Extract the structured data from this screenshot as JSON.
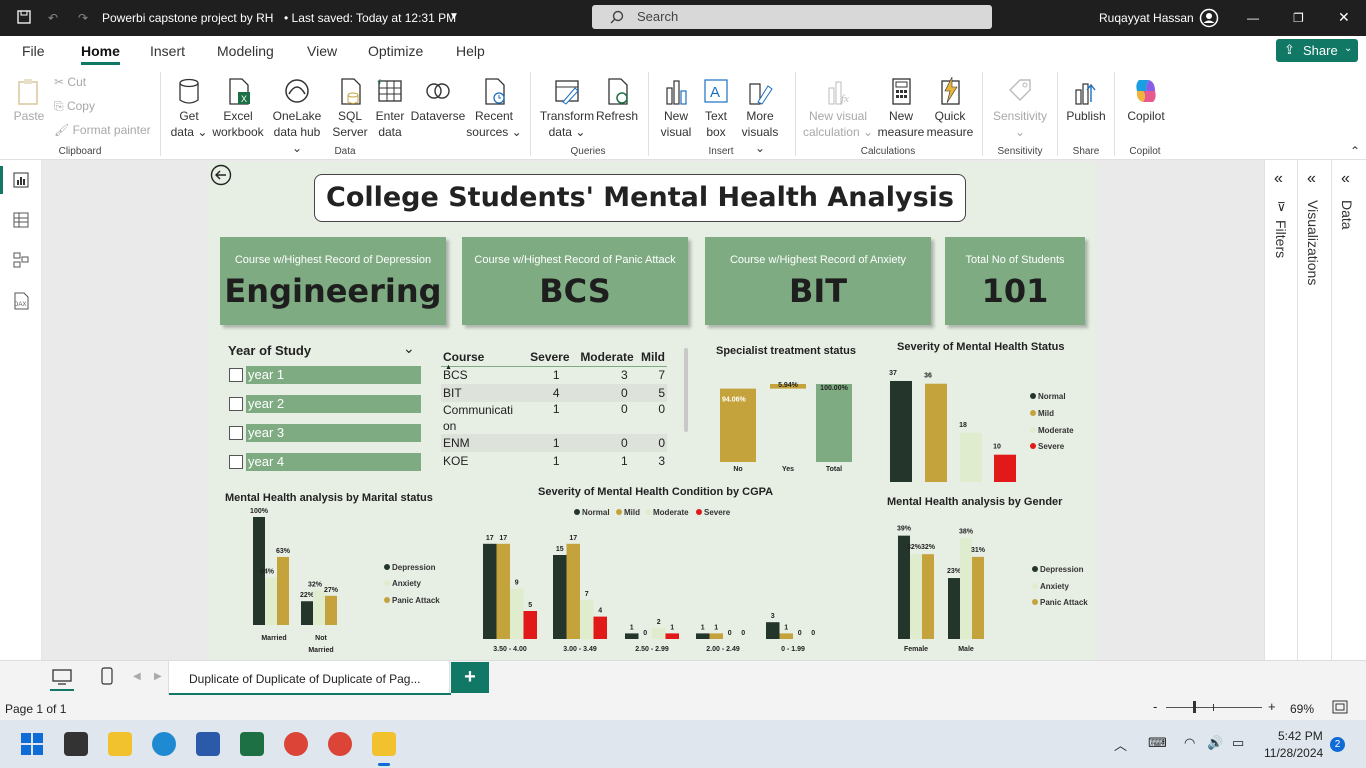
{
  "app": {
    "title": "Powerbi capstone project by RH",
    "saved": "Last saved: Today at 12:31 PM",
    "search_placeholder": "Search",
    "user": "Ruqayyat Hassan"
  },
  "menu": {
    "items": [
      "File",
      "Home",
      "Insert",
      "Modeling",
      "View",
      "Optimize",
      "Help"
    ],
    "share": "Share"
  },
  "ribbon": {
    "paste": "Paste",
    "cut": "Cut",
    "copy": "Copy",
    "format_painter": "Format painter",
    "clipboard": "Clipboard",
    "get_data": [
      "Get",
      "data"
    ],
    "excel": [
      "Excel",
      "workbook"
    ],
    "onelake": [
      "OneLake",
      "data hub"
    ],
    "sql": [
      "SQL",
      "Server"
    ],
    "enter": [
      "Enter",
      "data"
    ],
    "dataverse": "Dataverse",
    "recent": [
      "Recent",
      "sources"
    ],
    "data": "Data",
    "transform": [
      "Transform",
      "data"
    ],
    "refresh": "Refresh",
    "queries": "Queries",
    "new_visual": [
      "New",
      "visual"
    ],
    "text_box": [
      "Text",
      "box"
    ],
    "more_visuals": [
      "More",
      "visuals"
    ],
    "insert": "Insert",
    "new_visual_calc": [
      "New visual",
      "calculation"
    ],
    "new_measure": [
      "New",
      "measure"
    ],
    "quick_measure": [
      "Quick",
      "measure"
    ],
    "calculations": "Calculations",
    "sensitivity": "Sensitivity",
    "sensitivity_group": "Sensitivity",
    "publish": "Publish",
    "share": "Share",
    "copilot": "Copilot",
    "copilot_group": "Copilot"
  },
  "panes": {
    "filters": "Filters",
    "visualizations": "Visualizations",
    "data": "Data"
  },
  "report": {
    "title": "College Students' Mental Health Analysis",
    "kpis": [
      {
        "label": "Course w/Highest Record of Depression",
        "value": "Engineering"
      },
      {
        "label": "Course w/Highest Record of Panic Attack",
        "value": "BCS"
      },
      {
        "label": "Course w/Highest Record of Anxiety",
        "value": "BIT"
      },
      {
        "label": "Total No of Students",
        "value": "101"
      }
    ],
    "slicer": {
      "title": "Year of Study",
      "items": [
        "year 1",
        "year 2",
        "year 3",
        "year 4"
      ]
    },
    "table": {
      "headers": [
        "Course",
        "Severe",
        "Moderate",
        "Mild"
      ],
      "rows": [
        [
          "BCS",
          "1",
          "3",
          "7"
        ],
        [
          "BIT",
          "4",
          "0",
          "5"
        ],
        [
          "Communicati on",
          "1",
          "0",
          "0"
        ],
        [
          "ENM",
          "1",
          "0",
          "0"
        ],
        [
          "KOE",
          "1",
          "1",
          "3"
        ]
      ]
    },
    "colors": {
      "normal": "#24362b",
      "mild": "#c5a33c",
      "moderate": "#dfeccd",
      "severe": "#e11919",
      "green": "#7eab82"
    }
  },
  "chart_data": [
    {
      "type": "bar",
      "title": "Specialist treatment status",
      "categories": [
        "No",
        "Yes",
        "Total"
      ],
      "values": [
        94.06,
        5.94,
        100.0
      ],
      "labels": [
        "94.06%",
        "5.94%",
        "100.00%"
      ]
    },
    {
      "type": "bar",
      "title": "Severity of Mental Health Status",
      "categories": [
        "Normal",
        "Mild",
        "Moderate",
        "Severe"
      ],
      "values": [
        37,
        36,
        18,
        10
      ],
      "legend": [
        "Normal",
        "Mild",
        "Moderate",
        "Severe"
      ]
    },
    {
      "type": "bar",
      "title": "Mental Health analysis by Marital status",
      "categories": [
        "Married",
        "Not Married"
      ],
      "series": [
        {
          "name": "Depression",
          "values": [
            100,
            22
          ]
        },
        {
          "name": "Anxiety",
          "values": [
            44,
            32
          ]
        },
        {
          "name": "Panic Attack",
          "values": [
            63,
            27
          ]
        }
      ],
      "labels": [
        [
          "100%",
          "22%"
        ],
        [
          "44%",
          "32%"
        ],
        [
          "63%",
          "27%"
        ]
      ]
    },
    {
      "type": "bar",
      "title": "Severity of Mental Health Condition by CGPA",
      "categories": [
        "3.50 - 4.00",
        "3.00 - 3.49",
        "2.50 - 2.99",
        "2.00 - 2.49",
        "0 - 1.99"
      ],
      "series": [
        {
          "name": "Normal",
          "values": [
            17,
            15,
            1,
            1,
            3
          ]
        },
        {
          "name": "Mild",
          "values": [
            17,
            17,
            0,
            1,
            1
          ]
        },
        {
          "name": "Moderate",
          "values": [
            9,
            7,
            2,
            0,
            0
          ]
        },
        {
          "name": "Severe",
          "values": [
            5,
            4,
            1,
            0,
            0
          ]
        }
      ]
    },
    {
      "type": "bar",
      "title": "Mental Health analysis by Gender",
      "categories": [
        "Female",
        "Male"
      ],
      "series": [
        {
          "name": "Depression",
          "values": [
            39,
            23
          ]
        },
        {
          "name": "Anxiety",
          "values": [
            32,
            38
          ]
        },
        {
          "name": "Panic Attack",
          "values": [
            32,
            31
          ]
        }
      ],
      "labels": [
        [
          "39%",
          "23%"
        ],
        [
          "32%",
          "38%"
        ],
        [
          "32%",
          "31%"
        ]
      ]
    }
  ],
  "tabs": {
    "page": "Duplicate of Duplicate of Duplicate of Pag...",
    "add": "+"
  },
  "status": {
    "page": "Page 1 of 1",
    "zoom": "69%",
    "minus": "-",
    "plus": "+"
  },
  "taskbar": {
    "time": "5:42 PM",
    "date": "11/28/2024",
    "badge": "2"
  }
}
